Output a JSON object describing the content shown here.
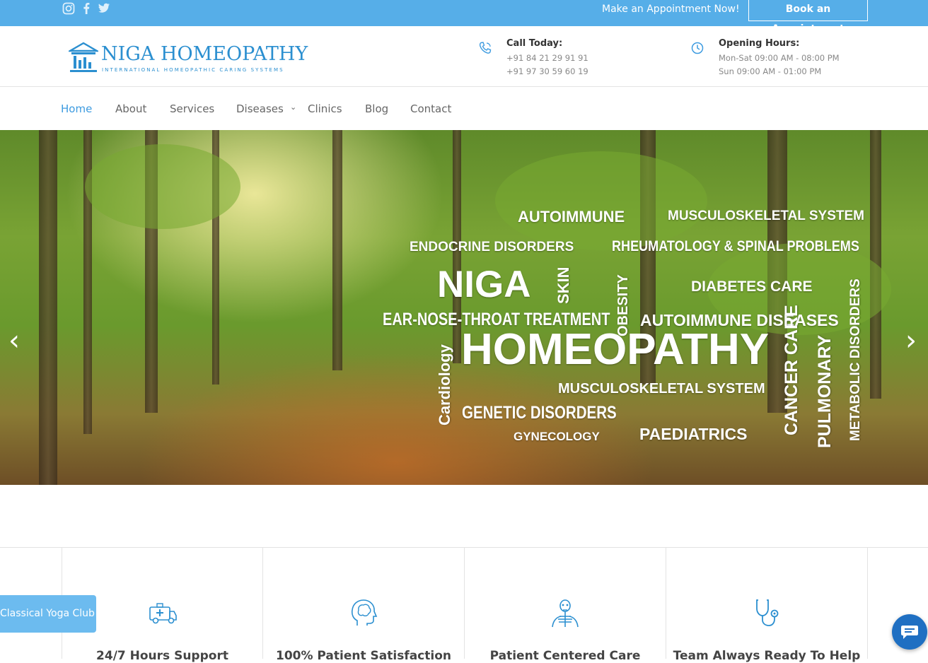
{
  "topbar": {
    "social": [
      "instagram-icon",
      "facebook-icon",
      "twitter-icon"
    ],
    "cta_text": "Make an Appointment Now!",
    "book_label": "Book an Appointment",
    "bg_color": "#56aee8"
  },
  "header": {
    "logo_title": "NIGA HOMEOPATHY",
    "logo_tagline": "INTERNATIONAL HOMEOPATHIC CARING SYSTEMS",
    "call": {
      "label": "Call Today:",
      "line1": "+91 84 21 29 91 91",
      "line2": "+91 97 30 59 60 19",
      "icon": "phone-icon"
    },
    "hours": {
      "label": "Opening Hours:",
      "line1": "Mon-Sat 09:00 AM - 08:00 PM",
      "line2": "Sun 09:00 AM - 01:00 PM",
      "icon": "clock-icon"
    }
  },
  "nav": {
    "items": [
      "Home",
      "About",
      "Services",
      "Diseases",
      "Clinics",
      "Blog",
      "Contact"
    ],
    "active": "Home",
    "accent": "#3d9be0"
  },
  "hero": {
    "words": [
      "AUTOIMMUNE",
      "MUSCULOSKELETAL SYSTEM",
      "ENDOCRINE DISORDERS",
      "RHEUMATOLOGY & SPINAL PROBLEMS",
      "NIGA",
      "SKIN",
      "OBESITY",
      "DIABETES CARE",
      "METABOLIC DISORDERS",
      "EAR-NOSE-THROAT TREATMENT",
      "AUTOIMMUNE DISEASES",
      "Cardiology",
      "HOMEOPATHY",
      "CANCER CARE",
      "PULMONARY",
      "MUSCULOSKELETAL SYSTEM",
      "GENETIC DISORDERS",
      "GYNECOLOGY",
      "PAEDIATRICS"
    ],
    "prev_icon": "chevron-left-icon",
    "next_icon": "chevron-right-icon"
  },
  "features": [
    {
      "title": "24/7 Hours Support",
      "icon": "ambulance-icon"
    },
    {
      "title": "100% Patient Satisfaction",
      "icon": "head-brain-icon"
    },
    {
      "title": "Patient Centered Care",
      "icon": "skeleton-icon"
    },
    {
      "title": "Team Always Ready To Help",
      "icon": "stethoscope-icon"
    }
  ],
  "yoga_tab": "Classical Yoga Club",
  "chat_icon": "chat-bubble-icon"
}
